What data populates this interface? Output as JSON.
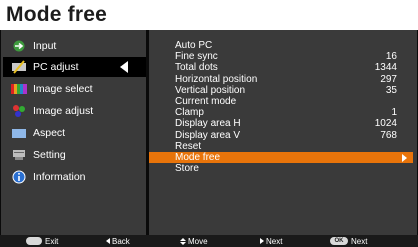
{
  "page": {
    "heading": "Mode free"
  },
  "menu": {
    "items": [
      {
        "label": "Input",
        "icon": "input-icon"
      },
      {
        "label": "PC adjust",
        "icon": "pc-adjust-icon",
        "selected": true
      },
      {
        "label": "Image select",
        "icon": "image-select-icon"
      },
      {
        "label": "Image adjust",
        "icon": "image-adjust-icon"
      },
      {
        "label": "Aspect",
        "icon": "aspect-icon"
      },
      {
        "label": "Setting",
        "icon": "setting-icon"
      },
      {
        "label": "Information",
        "icon": "information-icon"
      }
    ]
  },
  "submenu": {
    "rows": [
      {
        "label": "Auto PC",
        "value": ""
      },
      {
        "label": "Fine sync",
        "value": "16"
      },
      {
        "label": "Total dots",
        "value": "1344"
      },
      {
        "label": "Horizontal position",
        "value": "297"
      },
      {
        "label": "Vertical position",
        "value": "35"
      },
      {
        "label": "Current mode",
        "value": ""
      },
      {
        "label": "Clamp",
        "value": "1"
      },
      {
        "label": "Display area H",
        "value": "1024"
      },
      {
        "label": "Display area V",
        "value": "768"
      },
      {
        "label": "Reset",
        "value": ""
      },
      {
        "label": "Mode free",
        "value": "",
        "highlighted": true
      },
      {
        "label": "Store",
        "value": ""
      }
    ]
  },
  "guide": {
    "exit": "Exit",
    "back": "Back",
    "move": "Move",
    "next": "Next",
    "ok_key": "OK",
    "ok_next": "Next"
  },
  "colors": {
    "panel": "#3a3a3a",
    "highlight": "#e8740a",
    "selected_item": "#000000"
  }
}
